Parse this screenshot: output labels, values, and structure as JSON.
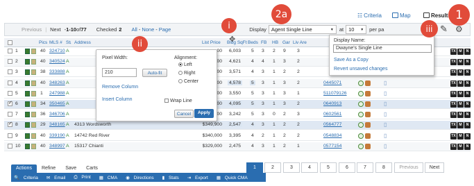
{
  "views": {
    "criteria": "Criteria",
    "map": "Map",
    "results": "Results"
  },
  "callouts": {
    "one": "1",
    "two_a": "2a",
    "i": "i",
    "ii": "ii",
    "iii": "iii"
  },
  "header": {
    "previous": "Previous",
    "next": "Next",
    "range_prefix": "- ",
    "range": "1-10",
    "of_label": " of ",
    "total": "77",
    "checked_label": "Checked",
    "checked_count": "2",
    "all": "All",
    "none": "None",
    "page": "Page",
    "sep1": "-",
    "sep2": "-",
    "display_label": "Display",
    "display_value": "Agent Single Line",
    "at_label": "at",
    "per_page_value": "10",
    "per_page_label": "per pa"
  },
  "columns": {
    "pics": "Pics",
    "mls": "MLS #",
    "st": "St",
    "address": "Address",
    "list_price": "List Price",
    "bldg_sqft": "Bldg SqFt",
    "beds": "Beds",
    "fb": "FB",
    "hb": "HB",
    "gar": "Gar",
    "liv_are": "Liv Are"
  },
  "rows": [
    {
      "n": "1",
      "pics": "40",
      "mls": "324710",
      "st": "A",
      "address": "",
      "price": "00",
      "sqft": "6,003",
      "beds": "5",
      "fb": "3",
      "hb": "2",
      "gar": "9",
      "liv": "3",
      "checked": false,
      "link": "",
      "extra": false
    },
    {
      "n": "2",
      "pics": "40",
      "mls": "340524",
      "st": "A",
      "address": "",
      "price": "00",
      "sqft": "4,621",
      "beds": "4",
      "fb": "4",
      "hb": "1",
      "gar": "3",
      "liv": "2",
      "checked": false,
      "link": "",
      "extra": false
    },
    {
      "n": "3",
      "pics": "38",
      "mls": "333888",
      "st": "A",
      "address": "",
      "price": "00",
      "sqft": "3,571",
      "beds": "4",
      "fb": "3",
      "hb": "1",
      "gar": "2",
      "liv": "2",
      "checked": false,
      "link": "",
      "extra": false
    },
    {
      "n": "4",
      "pics": "40",
      "mls": "348263",
      "st": "A",
      "address": "",
      "price": "00",
      "sqft": "4,578",
      "beds": "5",
      "fb": "3",
      "hb": "1",
      "gar": "3",
      "liv": "2",
      "checked": false,
      "link": "0445071",
      "extra": true
    },
    {
      "n": "5",
      "pics": "1",
      "mls": "247988",
      "st": "A",
      "address": "",
      "price": "00",
      "sqft": "3,550",
      "beds": "5",
      "fb": "3",
      "hb": "1",
      "gar": "3",
      "liv": "1",
      "checked": false,
      "link": "511079126",
      "extra": true
    },
    {
      "n": "6",
      "pics": "34",
      "mls": "350465",
      "st": "A",
      "address": "",
      "price": "00",
      "sqft": "4,095",
      "beds": "5",
      "fb": "3",
      "hb": "1",
      "gar": "3",
      "liv": "2",
      "checked": true,
      "link": "0640913",
      "extra": true
    },
    {
      "n": "7",
      "pics": "36",
      "mls": "346706",
      "st": "A",
      "address": "",
      "price": "00",
      "sqft": "3,242",
      "beds": "5",
      "fb": "3",
      "hb": "0",
      "gar": "2",
      "liv": "3",
      "checked": false,
      "link": "0602561",
      "extra": true
    },
    {
      "n": "8",
      "pics": "29",
      "mls": "348165",
      "st": "A",
      "address": "4313 Wordsworth",
      "price": "$349,900",
      "sqft": "2,547",
      "beds": "4",
      "fb": "3",
      "hb": "1",
      "gar": "2",
      "liv": "2",
      "checked": true,
      "link": "0564777",
      "extra": true
    },
    {
      "n": "9",
      "pics": "40",
      "mls": "339190",
      "st": "A",
      "address": "14742 Red River",
      "price": "$340,000",
      "sqft": "3,395",
      "beds": "4",
      "fb": "2",
      "hb": "1",
      "gar": "2",
      "liv": "2",
      "checked": false,
      "link": "0548834",
      "extra": true
    },
    {
      "n": "10",
      "pics": "40",
      "mls": "348997",
      "st": "A",
      "address": "15317 Chianti",
      "price": "$329,000",
      "sqft": "2,475",
      "beds": "4",
      "fb": "3",
      "hb": "1",
      "gar": "2",
      "liv": "1",
      "checked": false,
      "link": "0577154",
      "extra": true
    }
  ],
  "badges": {
    "tx": "TX",
    "m": "M",
    "n": "N"
  },
  "pixel_popup": {
    "pixel_width_label": "Pixel Width:",
    "pixel_width_value": "210",
    "autofit": "Auto-fit",
    "alignment_label": "Alignment:",
    "left": "Left",
    "right": "Right",
    "center": "Center",
    "remove_column": "Remove Column",
    "insert_column": "Insert Column",
    "wrap_line": "Wrap Line",
    "cancel": "Cancel",
    "apply": "Apply"
  },
  "display_popup": {
    "display_name_label": "Display Name:",
    "display_name_value": "Dwayne's Single Line",
    "save_as_copy": "Save As a Copy",
    "revert": "Revert unsaved changes"
  },
  "bottom": {
    "tabs": [
      "Actions",
      "Refine",
      "Save",
      "Carts"
    ],
    "actions": [
      "Criteria",
      "Email",
      "Print",
      "CMA",
      "Directions",
      "Stats",
      "Export",
      "Quick CMA"
    ],
    "pages": [
      "1",
      "2",
      "3",
      "4",
      "5",
      "6",
      "7",
      "8"
    ],
    "previous": "Previous",
    "next": "Next"
  },
  "colors": {
    "accent": "#2a6db0",
    "callout": "#e14b3a"
  }
}
